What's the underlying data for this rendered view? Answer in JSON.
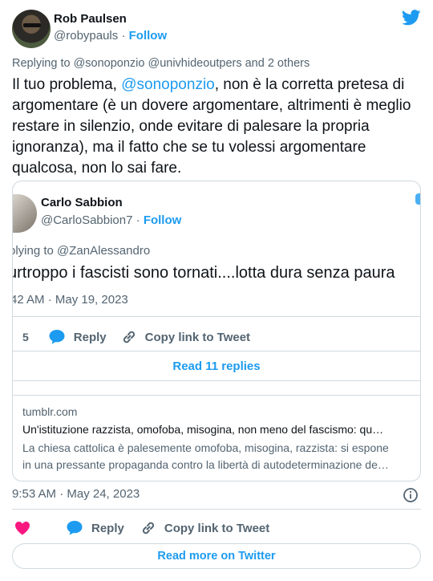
{
  "author": {
    "name": "Rob Paulsen",
    "handle": "@robypauls",
    "separator": "·",
    "follow_label": "Follow"
  },
  "replying_to": "Replying to @sonoponzio @univhideoutpers and 2 others",
  "tweet": {
    "text_before": "Il tuo problema, ",
    "mention": "@sonoponzio",
    "text_after": ", non è la corretta pretesa di argomentare (è un dovere argomentare, altrimenti è meglio restare in silenzio, onde evitare di palesare la propria ignoranza), ma il fatto che se tu volessi argomentare qualcosa, non lo sai fare."
  },
  "quoted_tweet": {
    "name": "Carlo Sabbion",
    "handle": "@CarloSabbion7",
    "separator": "·",
    "follow_label": "Follow",
    "replying_to": "plying to @ZanAlessandro",
    "text": "urtroppo i fascisti sono tornati....lotta dura senza paura",
    "time": "42 AM · May 19, 2023",
    "like_count": "5",
    "reply_label": "Reply",
    "copy_link_label": "Copy link to Tweet",
    "read_replies_label": "Read 11 replies"
  },
  "link_card": {
    "domain": "tumblr.com",
    "title": "Un'istituzione razzista, omofoba, misogina, non meno del fascismo: qu…",
    "description_line1": "La chiesa cattolica è palesemente omofoba, misogina, razzista: si espone",
    "description_line2": "in una pressante propaganda contro la libertà di autodeterminazione de…"
  },
  "timestamp": "9:53 AM · May 24, 2023",
  "actions": {
    "reply_label": "Reply",
    "copy_link_label": "Copy link to Tweet"
  },
  "read_more_label": "Read more on Twitter",
  "colors": {
    "accent": "#1d9bf0",
    "heart": "#f91880",
    "secondary_text": "#536471",
    "border": "#cfd9de"
  }
}
